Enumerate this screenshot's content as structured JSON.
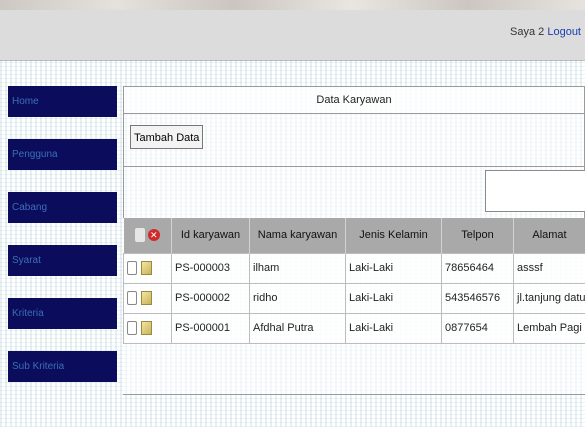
{
  "header": {
    "user": "Saya 2",
    "logout": "Logout"
  },
  "sidebar": {
    "items": [
      {
        "label": "Home"
      },
      {
        "label": "Pengguna"
      },
      {
        "label": "Cabang"
      },
      {
        "label": "Syarat"
      },
      {
        "label": "Kriteria"
      },
      {
        "label": "Sub Kriteria"
      }
    ]
  },
  "panel": {
    "title": "Data Karyawan",
    "add_button": "Tambah Data",
    "search_value": ""
  },
  "table": {
    "columns": [
      "Id karyawan",
      "Nama karyawan",
      "Jenis Kelamin",
      "Telpon",
      "Alamat"
    ],
    "rows": [
      {
        "id": "PS-000003",
        "nama": "ilham",
        "jk": "Laki-Laki",
        "telpon": "78656464",
        "alamat": "asssf"
      },
      {
        "id": "PS-000002",
        "nama": "ridho",
        "jk": "Laki-Laki",
        "telpon": "543546576",
        "alamat": "jl.tanjung datuk"
      },
      {
        "id": "PS-000001",
        "nama": "Afdhal Putra",
        "jk": "Laki-Laki",
        "telpon": "0877654",
        "alamat": "Lembah Pagi"
      }
    ]
  },
  "colors": {
    "sidebar_bg": "#0c0c5c",
    "sidebar_text": "#3a6fb8",
    "table_header_bg": "#a9a9a9",
    "delete_icon": "#d12a2a",
    "logout_link": "#1a3fb0"
  },
  "icons": {
    "delete_all": "x-circle-icon",
    "edit": "edit-icon",
    "select": "checkbox"
  }
}
